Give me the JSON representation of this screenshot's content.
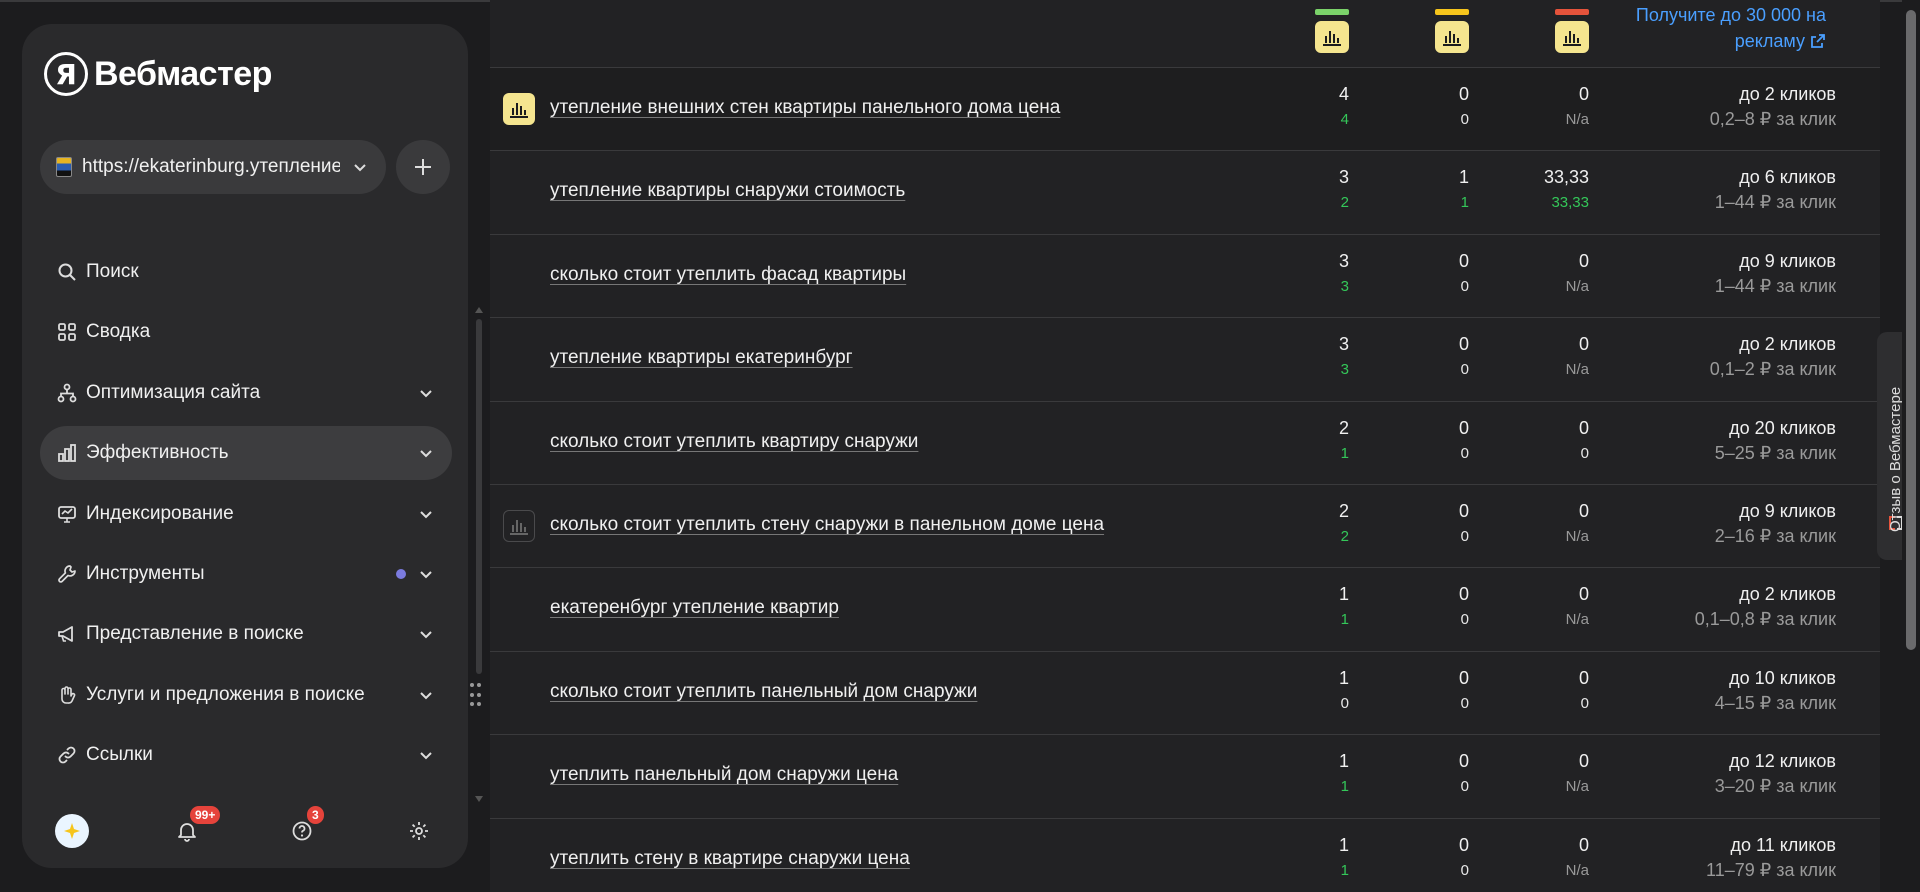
{
  "app": {
    "logo_glyph": "Я",
    "logo_text": "Вебмастер"
  },
  "site": {
    "url": "https://ekaterinburg.утепление"
  },
  "nav": [
    {
      "label": "Поиск",
      "icon": "search-icon"
    },
    {
      "label": "Сводка",
      "icon": "grid-icon"
    },
    {
      "label": "Оптимизация сайта",
      "icon": "sitemap-icon"
    },
    {
      "label": "Эффективность",
      "icon": "chart-icon",
      "active": true
    },
    {
      "label": "Индексирование",
      "icon": "monitor-icon"
    },
    {
      "label": "Инструменты",
      "icon": "wrench-icon",
      "dot": true
    },
    {
      "label": "Представление в поиске",
      "icon": "megaphone-icon"
    },
    {
      "label": "Услуги и предложения в поиске",
      "icon": "hand-icon"
    },
    {
      "label": "Ссылки",
      "icon": "link-icon"
    }
  ],
  "bottom": {
    "notifications_badge": "99+",
    "help_badge": "3"
  },
  "header": {
    "promo": "Получите до 30 000 на рекламу",
    "col_colors": [
      "#7bd36a",
      "#f6c51c",
      "#e5533b"
    ]
  },
  "rows": [
    {
      "query": "утепление внешних стен квартиры панельного дома цена",
      "icon": "on",
      "c1": "4",
      "c1d": "4",
      "c1g": true,
      "c2": "0",
      "c2d": "0",
      "c2g": false,
      "c3": "0",
      "c3d": "N/a",
      "clicks": "до 2 кликов",
      "price": "0,2–8 ₽ за клик"
    },
    {
      "query": "утепление квартиры снаружи стоимость",
      "icon": "",
      "c1": "3",
      "c1d": "2",
      "c1g": true,
      "c2": "1",
      "c2d": "1",
      "c2g": true,
      "c3": "33,33",
      "c3d": "33,33",
      "clicks": "до 6 кликов",
      "price": "1–44 ₽ за клик"
    },
    {
      "query": "сколько стоит утеплить фасад квартиры",
      "icon": "",
      "c1": "3",
      "c1d": "3",
      "c1g": true,
      "c2": "0",
      "c2d": "0",
      "c2g": false,
      "c3": "0",
      "c3d": "N/a",
      "clicks": "до 9 кликов",
      "price": "1–44 ₽ за клик"
    },
    {
      "query": "утепление квартиры екатеринбург",
      "icon": "",
      "c1": "3",
      "c1d": "3",
      "c1g": true,
      "c2": "0",
      "c2d": "0",
      "c2g": false,
      "c3": "0",
      "c3d": "N/a",
      "clicks": "до 2 кликов",
      "price": "0,1–2 ₽ за клик"
    },
    {
      "query": "сколько стоит утеплить квартиру снаружи",
      "icon": "",
      "c1": "2",
      "c1d": "1",
      "c1g": true,
      "c2": "0",
      "c2d": "0",
      "c2g": false,
      "c3": "0",
      "c3d": "0",
      "clicks": "до 20 кликов",
      "price": "5–25 ₽ за клик"
    },
    {
      "query": "сколько стоит утеплить стену снаружи в панельном доме цена",
      "icon": "off",
      "c1": "2",
      "c1d": "2",
      "c1g": true,
      "c2": "0",
      "c2d": "0",
      "c2g": false,
      "c3": "0",
      "c3d": "N/a",
      "clicks": "до 9 кликов",
      "price": "2–16 ₽ за клик"
    },
    {
      "query": "екатеренбург утепление квартир",
      "icon": "",
      "c1": "1",
      "c1d": "1",
      "c1g": true,
      "c2": "0",
      "c2d": "0",
      "c2g": false,
      "c3": "0",
      "c3d": "N/a",
      "clicks": "до 2 кликов",
      "price": "0,1–0,8 ₽ за клик"
    },
    {
      "query": "сколько стоит утеплить панельный дом снаружи",
      "icon": "",
      "c1": "1",
      "c1d": "0",
      "c1g": false,
      "c2": "0",
      "c2d": "0",
      "c2g": false,
      "c3": "0",
      "c3d": "0",
      "clicks": "до 10 кликов",
      "price": "4–15 ₽ за клик"
    },
    {
      "query": "утеплить панельный дом снаружи цена",
      "icon": "",
      "c1": "1",
      "c1d": "1",
      "c1g": true,
      "c2": "0",
      "c2d": "0",
      "c2g": false,
      "c3": "0",
      "c3d": "N/a",
      "clicks": "до 12 кликов",
      "price": "3–20 ₽ за клик"
    },
    {
      "query": "утеплить стену в квартире снаружи цена",
      "icon": "",
      "c1": "1",
      "c1d": "1",
      "c1g": true,
      "c2": "0",
      "c2d": "0",
      "c2g": false,
      "c3": "0",
      "c3d": "N/a",
      "clicks": "до 11 кликов",
      "price": "11–79 ₽ за клик"
    }
  ],
  "feedback": {
    "label": "Отзыв о Вебмастере"
  }
}
